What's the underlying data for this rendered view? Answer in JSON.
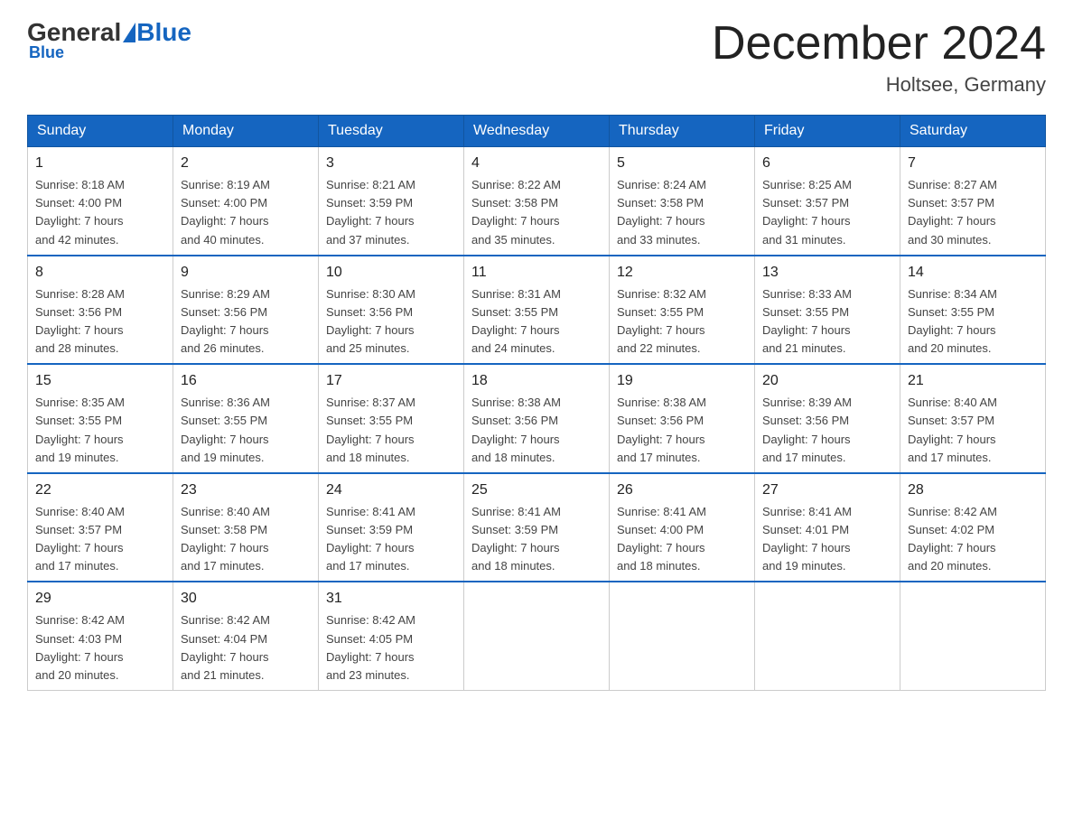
{
  "header": {
    "logo_general": "General",
    "logo_blue": "Blue",
    "month_title": "December 2024",
    "location": "Holtsee, Germany"
  },
  "days_of_week": [
    "Sunday",
    "Monday",
    "Tuesday",
    "Wednesday",
    "Thursday",
    "Friday",
    "Saturday"
  ],
  "weeks": [
    [
      {
        "day": 1,
        "info": "Sunrise: 8:18 AM\nSunset: 4:00 PM\nDaylight: 7 hours\nand 42 minutes."
      },
      {
        "day": 2,
        "info": "Sunrise: 8:19 AM\nSunset: 4:00 PM\nDaylight: 7 hours\nand 40 minutes."
      },
      {
        "day": 3,
        "info": "Sunrise: 8:21 AM\nSunset: 3:59 PM\nDaylight: 7 hours\nand 37 minutes."
      },
      {
        "day": 4,
        "info": "Sunrise: 8:22 AM\nSunset: 3:58 PM\nDaylight: 7 hours\nand 35 minutes."
      },
      {
        "day": 5,
        "info": "Sunrise: 8:24 AM\nSunset: 3:58 PM\nDaylight: 7 hours\nand 33 minutes."
      },
      {
        "day": 6,
        "info": "Sunrise: 8:25 AM\nSunset: 3:57 PM\nDaylight: 7 hours\nand 31 minutes."
      },
      {
        "day": 7,
        "info": "Sunrise: 8:27 AM\nSunset: 3:57 PM\nDaylight: 7 hours\nand 30 minutes."
      }
    ],
    [
      {
        "day": 8,
        "info": "Sunrise: 8:28 AM\nSunset: 3:56 PM\nDaylight: 7 hours\nand 28 minutes."
      },
      {
        "day": 9,
        "info": "Sunrise: 8:29 AM\nSunset: 3:56 PM\nDaylight: 7 hours\nand 26 minutes."
      },
      {
        "day": 10,
        "info": "Sunrise: 8:30 AM\nSunset: 3:56 PM\nDaylight: 7 hours\nand 25 minutes."
      },
      {
        "day": 11,
        "info": "Sunrise: 8:31 AM\nSunset: 3:55 PM\nDaylight: 7 hours\nand 24 minutes."
      },
      {
        "day": 12,
        "info": "Sunrise: 8:32 AM\nSunset: 3:55 PM\nDaylight: 7 hours\nand 22 minutes."
      },
      {
        "day": 13,
        "info": "Sunrise: 8:33 AM\nSunset: 3:55 PM\nDaylight: 7 hours\nand 21 minutes."
      },
      {
        "day": 14,
        "info": "Sunrise: 8:34 AM\nSunset: 3:55 PM\nDaylight: 7 hours\nand 20 minutes."
      }
    ],
    [
      {
        "day": 15,
        "info": "Sunrise: 8:35 AM\nSunset: 3:55 PM\nDaylight: 7 hours\nand 19 minutes."
      },
      {
        "day": 16,
        "info": "Sunrise: 8:36 AM\nSunset: 3:55 PM\nDaylight: 7 hours\nand 19 minutes."
      },
      {
        "day": 17,
        "info": "Sunrise: 8:37 AM\nSunset: 3:55 PM\nDaylight: 7 hours\nand 18 minutes."
      },
      {
        "day": 18,
        "info": "Sunrise: 8:38 AM\nSunset: 3:56 PM\nDaylight: 7 hours\nand 18 minutes."
      },
      {
        "day": 19,
        "info": "Sunrise: 8:38 AM\nSunset: 3:56 PM\nDaylight: 7 hours\nand 17 minutes."
      },
      {
        "day": 20,
        "info": "Sunrise: 8:39 AM\nSunset: 3:56 PM\nDaylight: 7 hours\nand 17 minutes."
      },
      {
        "day": 21,
        "info": "Sunrise: 8:40 AM\nSunset: 3:57 PM\nDaylight: 7 hours\nand 17 minutes."
      }
    ],
    [
      {
        "day": 22,
        "info": "Sunrise: 8:40 AM\nSunset: 3:57 PM\nDaylight: 7 hours\nand 17 minutes."
      },
      {
        "day": 23,
        "info": "Sunrise: 8:40 AM\nSunset: 3:58 PM\nDaylight: 7 hours\nand 17 minutes."
      },
      {
        "day": 24,
        "info": "Sunrise: 8:41 AM\nSunset: 3:59 PM\nDaylight: 7 hours\nand 17 minutes."
      },
      {
        "day": 25,
        "info": "Sunrise: 8:41 AM\nSunset: 3:59 PM\nDaylight: 7 hours\nand 18 minutes."
      },
      {
        "day": 26,
        "info": "Sunrise: 8:41 AM\nSunset: 4:00 PM\nDaylight: 7 hours\nand 18 minutes."
      },
      {
        "day": 27,
        "info": "Sunrise: 8:41 AM\nSunset: 4:01 PM\nDaylight: 7 hours\nand 19 minutes."
      },
      {
        "day": 28,
        "info": "Sunrise: 8:42 AM\nSunset: 4:02 PM\nDaylight: 7 hours\nand 20 minutes."
      }
    ],
    [
      {
        "day": 29,
        "info": "Sunrise: 8:42 AM\nSunset: 4:03 PM\nDaylight: 7 hours\nand 20 minutes."
      },
      {
        "day": 30,
        "info": "Sunrise: 8:42 AM\nSunset: 4:04 PM\nDaylight: 7 hours\nand 21 minutes."
      },
      {
        "day": 31,
        "info": "Sunrise: 8:42 AM\nSunset: 4:05 PM\nDaylight: 7 hours\nand 23 minutes."
      },
      null,
      null,
      null,
      null
    ]
  ]
}
